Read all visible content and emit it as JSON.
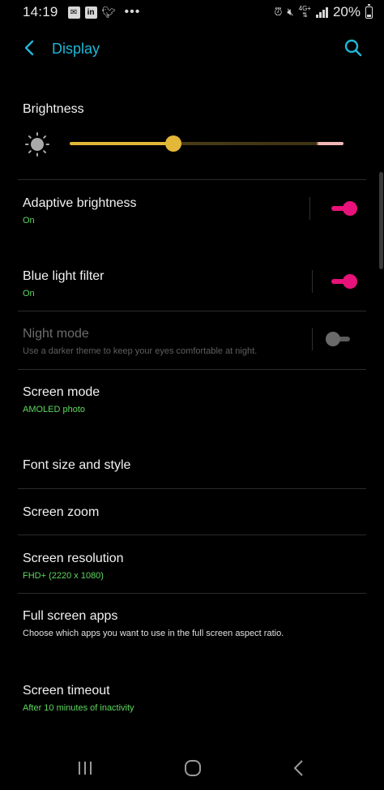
{
  "status_bar": {
    "time": "14:19",
    "network": "4G+",
    "battery": "20%",
    "left_icons": [
      "email-icon",
      "linkedin-icon",
      "twitter-icon",
      "more-dots-icon"
    ],
    "right_icons": [
      "alarm-icon",
      "mute-icon",
      "signal-icon",
      "battery-icon"
    ]
  },
  "header": {
    "title": "Display",
    "accent_color": "#1fb8d8"
  },
  "brightness": {
    "title": "Brightness",
    "level": 0.38,
    "track_color": "#e3b738"
  },
  "settings": {
    "adaptive_brightness": {
      "title": "Adaptive brightness",
      "subtitle": "On",
      "enabled": true
    },
    "blue_light_filter": {
      "title": "Blue light filter",
      "subtitle": "On",
      "enabled": true
    },
    "night_mode": {
      "title": "Night mode",
      "subtitle": "Use a darker theme to keep your eyes comfortable at night.",
      "enabled": false
    },
    "screen_mode": {
      "title": "Screen mode",
      "subtitle": "AMOLED photo"
    },
    "font_size_style": {
      "title": "Font size and style"
    },
    "screen_zoom": {
      "title": "Screen zoom"
    },
    "screen_resolution": {
      "title": "Screen resolution",
      "subtitle": "FHD+ (2220 x 1080)"
    },
    "full_screen_apps": {
      "title": "Full screen apps",
      "subtitle": "Choose which apps you want to use in the full screen aspect ratio."
    },
    "screen_timeout": {
      "title": "Screen timeout",
      "subtitle": "After 10 minutes of inactivity"
    }
  },
  "colors": {
    "toggle_on": "#e8127a",
    "subtitle_green": "#5dd95d"
  },
  "nav_bar": {
    "icons": [
      "recents-icon",
      "home-icon",
      "back-icon"
    ]
  }
}
